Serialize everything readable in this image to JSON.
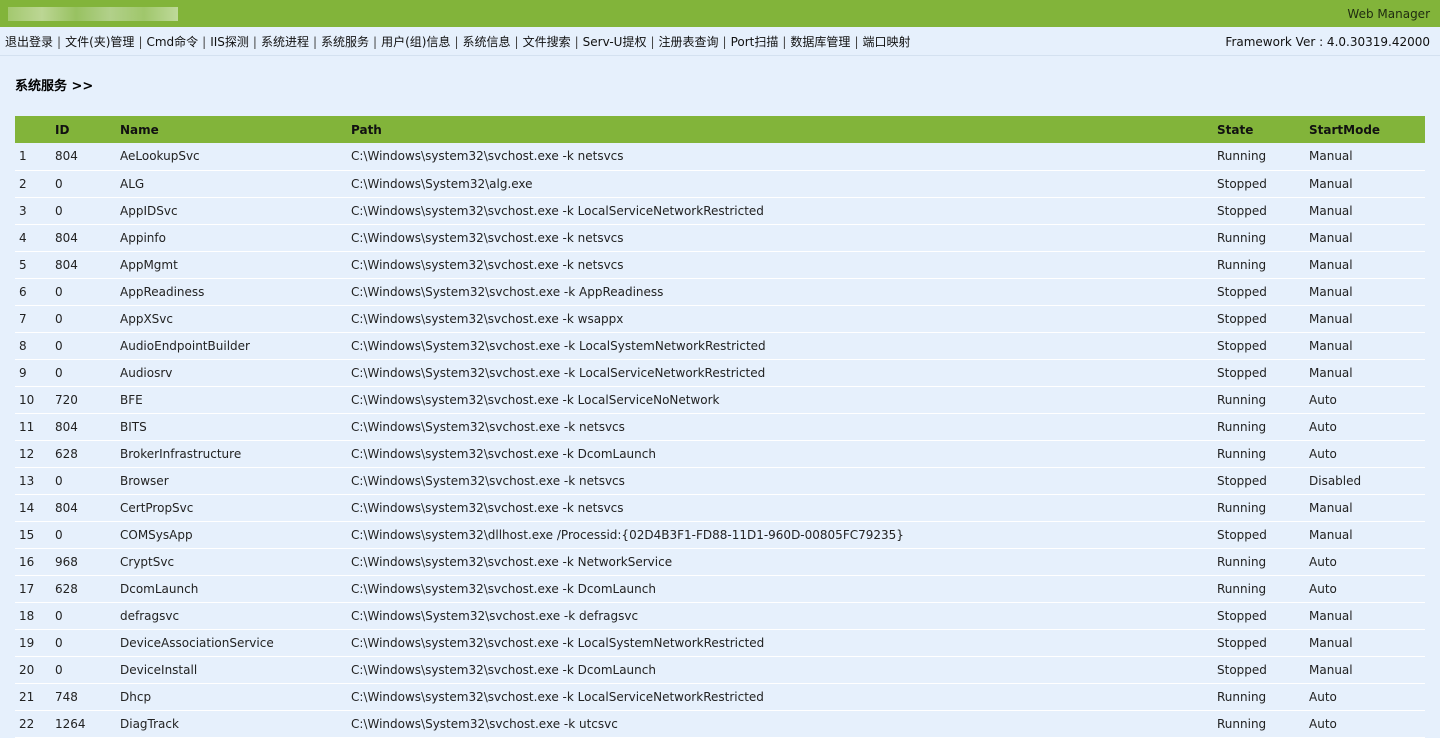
{
  "topbar": {
    "brand": "Web Manager"
  },
  "menu": {
    "items": [
      "退出登录",
      "文件(夹)管理",
      "Cmd命令",
      "IIS探测",
      "系统进程",
      "系统服务",
      "用户(组)信息",
      "系统信息",
      "文件搜索",
      "Serv-U提权",
      "注册表查询",
      "Port扫描",
      "数据库管理",
      "端口映射"
    ],
    "separator": "|",
    "framework": "Framework Ver : 4.0.30319.42000"
  },
  "section": {
    "title": "系统服务 >>"
  },
  "table": {
    "headers": [
      "",
      "ID",
      "Name",
      "Path",
      "State",
      "StartMode"
    ],
    "rows": [
      [
        "1",
        "804",
        "AeLookupSvc",
        "C:\\Windows\\system32\\svchost.exe -k netsvcs",
        "Running",
        "Manual"
      ],
      [
        "2",
        "0",
        "ALG",
        "C:\\Windows\\System32\\alg.exe",
        "Stopped",
        "Manual"
      ],
      [
        "3",
        "0",
        "AppIDSvc",
        "C:\\Windows\\system32\\svchost.exe -k LocalServiceNetworkRestricted",
        "Stopped",
        "Manual"
      ],
      [
        "4",
        "804",
        "Appinfo",
        "C:\\Windows\\system32\\svchost.exe -k netsvcs",
        "Running",
        "Manual"
      ],
      [
        "5",
        "804",
        "AppMgmt",
        "C:\\Windows\\system32\\svchost.exe -k netsvcs",
        "Running",
        "Manual"
      ],
      [
        "6",
        "0",
        "AppReadiness",
        "C:\\Windows\\System32\\svchost.exe -k AppReadiness",
        "Stopped",
        "Manual"
      ],
      [
        "7",
        "0",
        "AppXSvc",
        "C:\\Windows\\system32\\svchost.exe -k wsappx",
        "Stopped",
        "Manual"
      ],
      [
        "8",
        "0",
        "AudioEndpointBuilder",
        "C:\\Windows\\System32\\svchost.exe -k LocalSystemNetworkRestricted",
        "Stopped",
        "Manual"
      ],
      [
        "9",
        "0",
        "Audiosrv",
        "C:\\Windows\\System32\\svchost.exe -k LocalServiceNetworkRestricted",
        "Stopped",
        "Manual"
      ],
      [
        "10",
        "720",
        "BFE",
        "C:\\Windows\\system32\\svchost.exe -k LocalServiceNoNetwork",
        "Running",
        "Auto"
      ],
      [
        "11",
        "804",
        "BITS",
        "C:\\Windows\\System32\\svchost.exe -k netsvcs",
        "Running",
        "Auto"
      ],
      [
        "12",
        "628",
        "BrokerInfrastructure",
        "C:\\Windows\\system32\\svchost.exe -k DcomLaunch",
        "Running",
        "Auto"
      ],
      [
        "13",
        "0",
        "Browser",
        "C:\\Windows\\System32\\svchost.exe -k netsvcs",
        "Stopped",
        "Disabled"
      ],
      [
        "14",
        "804",
        "CertPropSvc",
        "C:\\Windows\\system32\\svchost.exe -k netsvcs",
        "Running",
        "Manual"
      ],
      [
        "15",
        "0",
        "COMSysApp",
        "C:\\Windows\\system32\\dllhost.exe /Processid:{02D4B3F1-FD88-11D1-960D-00805FC79235}",
        "Stopped",
        "Manual"
      ],
      [
        "16",
        "968",
        "CryptSvc",
        "C:\\Windows\\system32\\svchost.exe -k NetworkService",
        "Running",
        "Auto"
      ],
      [
        "17",
        "628",
        "DcomLaunch",
        "C:\\Windows\\system32\\svchost.exe -k DcomLaunch",
        "Running",
        "Auto"
      ],
      [
        "18",
        "0",
        "defragsvc",
        "C:\\Windows\\System32\\svchost.exe -k defragsvc",
        "Stopped",
        "Manual"
      ],
      [
        "19",
        "0",
        "DeviceAssociationService",
        "C:\\Windows\\system32\\svchost.exe -k LocalSystemNetworkRestricted",
        "Stopped",
        "Manual"
      ],
      [
        "20",
        "0",
        "DeviceInstall",
        "C:\\Windows\\system32\\svchost.exe -k DcomLaunch",
        "Stopped",
        "Manual"
      ],
      [
        "21",
        "748",
        "Dhcp",
        "C:\\Windows\\system32\\svchost.exe -k LocalServiceNetworkRestricted",
        "Running",
        "Auto"
      ],
      [
        "22",
        "1264",
        "DiagTrack",
        "C:\\Windows\\System32\\svchost.exe -k utcsvc",
        "Running",
        "Auto"
      ]
    ]
  },
  "colors": {
    "accent": "#82b43a",
    "background": "#e6f0fc",
    "running": "#2e8b1e",
    "stopped": "#e02020"
  }
}
